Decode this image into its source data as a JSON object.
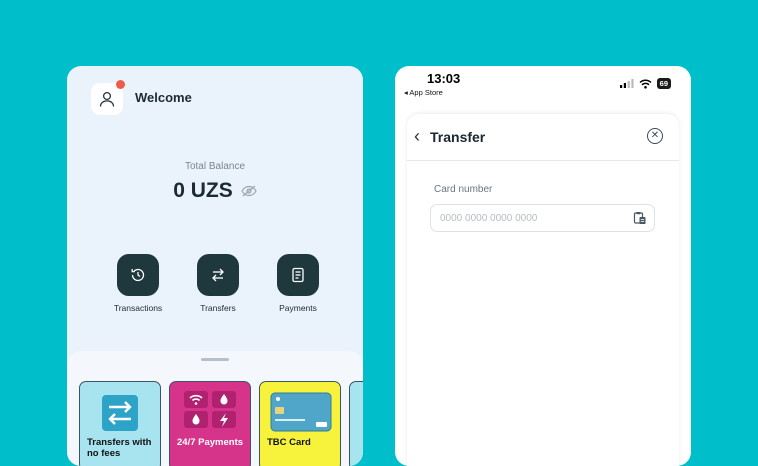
{
  "left_screen": {
    "greeting": "Welcome",
    "balance": {
      "label": "Total Balance",
      "amount": "0 UZS"
    },
    "actions": [
      {
        "label": "Transactions",
        "icon": "history-icon"
      },
      {
        "label": "Transfers",
        "icon": "transfer-arrows-icon"
      },
      {
        "label": "Payments",
        "icon": "receipt-icon"
      }
    ],
    "cards": [
      {
        "label": "Transfers with no fees",
        "bg": "#A8E3F0"
      },
      {
        "label": "24/7 Payments",
        "bg": "#D6338A"
      },
      {
        "label": "TBC Card",
        "bg": "#F7F23B"
      }
    ],
    "colors": {
      "screen_bg": "#EAF2FB",
      "action_button": "#1E383E",
      "notification_dot": "#F05A4A"
    }
  },
  "right_screen": {
    "status_bar": {
      "time": "13:03",
      "back_to_app": "◂ App Store",
      "battery": "69"
    },
    "modal": {
      "title": "Transfer",
      "field_label": "Card number",
      "field_placeholder": "0000 0000 0000 0000",
      "field_value": ""
    }
  },
  "background_color": "#00BFCB"
}
